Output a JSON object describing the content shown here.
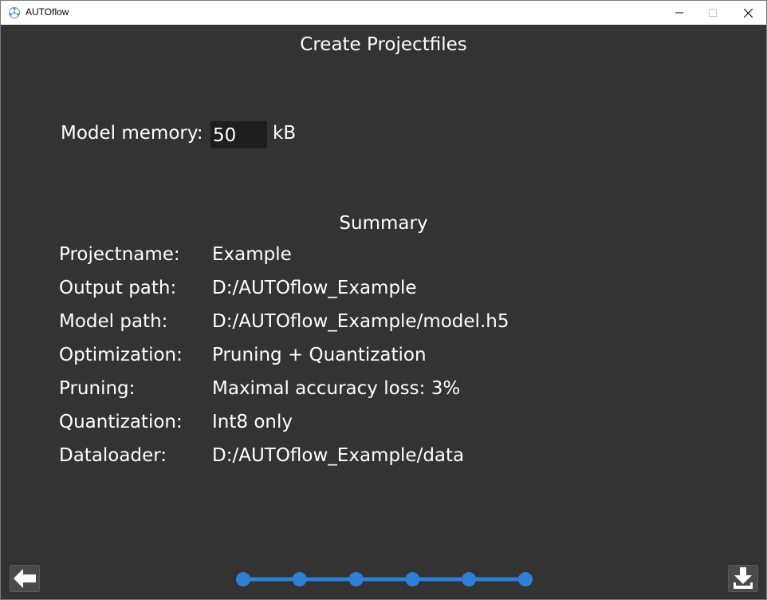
{
  "window": {
    "title": "AUTOflow",
    "controls": {
      "minimize": "minimize-icon",
      "maximize": "maximize-icon",
      "close": "close-icon"
    }
  },
  "page": {
    "title": "Create Projectfiles"
  },
  "memory": {
    "label": "Model memory:",
    "value": "50",
    "unit": "kB"
  },
  "summary": {
    "title": "Summary",
    "rows": [
      {
        "key": "Projectname:",
        "value": "Example"
      },
      {
        "key": "Output path:",
        "value": "D:/AUTOflow_Example"
      },
      {
        "key": "Model path:",
        "value": "D:/AUTOflow_Example/model.h5"
      },
      {
        "key": "Optimization:",
        "value": "Pruning + Quantization"
      },
      {
        "key": "Pruning:",
        "value": "Maximal accuracy loss: 3%"
      },
      {
        "key": "Quantization:",
        "value": "Int8 only"
      },
      {
        "key": "Dataloader:",
        "value": "D:/AUTOflow_Example/data"
      }
    ]
  },
  "navigation": {
    "back_icon": "arrow-left-icon",
    "download_icon": "download-icon",
    "steps_total": 6,
    "steps_completed": 6
  },
  "colors": {
    "background": "#333333",
    "text": "#ffffff",
    "input_background": "#1e1e1e",
    "accent": "#2f7fd6",
    "titlebar": "#ffffff"
  }
}
